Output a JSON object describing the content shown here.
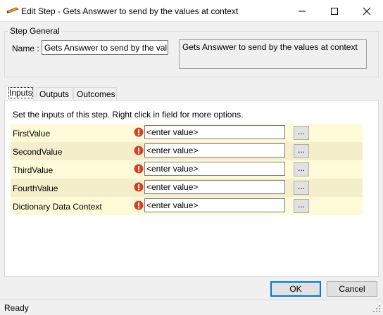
{
  "window": {
    "title": "Edit Step - Gets Answwer to send by the values at context",
    "icon": "edit-step-icon",
    "controls": [
      "minimize-icon",
      "maximize-icon",
      "close-icon"
    ]
  },
  "step_general": {
    "legend": "Step General",
    "name_label": "Name :",
    "name_value": "Gets Answwer to send by the values",
    "description": "Gets Answwer to send by the values at context"
  },
  "tabs": [
    {
      "label": "Inputs",
      "active": true
    },
    {
      "label": "Outputs",
      "active": false
    },
    {
      "label": "Outcomes",
      "active": false
    }
  ],
  "inputs": {
    "hint": "Set the inputs of this step.  Right click in field for more options.",
    "rows": [
      {
        "label": "FirstValue",
        "value": "<enter value>",
        "button": "..."
      },
      {
        "label": "SecondValue",
        "value": "<enter value>",
        "button": "..."
      },
      {
        "label": "ThirdValue",
        "value": "<enter value>",
        "button": "..."
      },
      {
        "label": "FourthValue",
        "value": "<enter value>",
        "button": "..."
      },
      {
        "label": "Dictionary Data Context",
        "value": "<enter value>",
        "button": "..."
      }
    ]
  },
  "buttons": {
    "ok": "OK",
    "cancel": "Cancel"
  },
  "status": {
    "text": "Ready"
  },
  "colors": {
    "row_light": "#fffbd9",
    "row_dark": "#f5eecb",
    "error_icon": "#d64025",
    "ok_border": "#0078d7"
  }
}
